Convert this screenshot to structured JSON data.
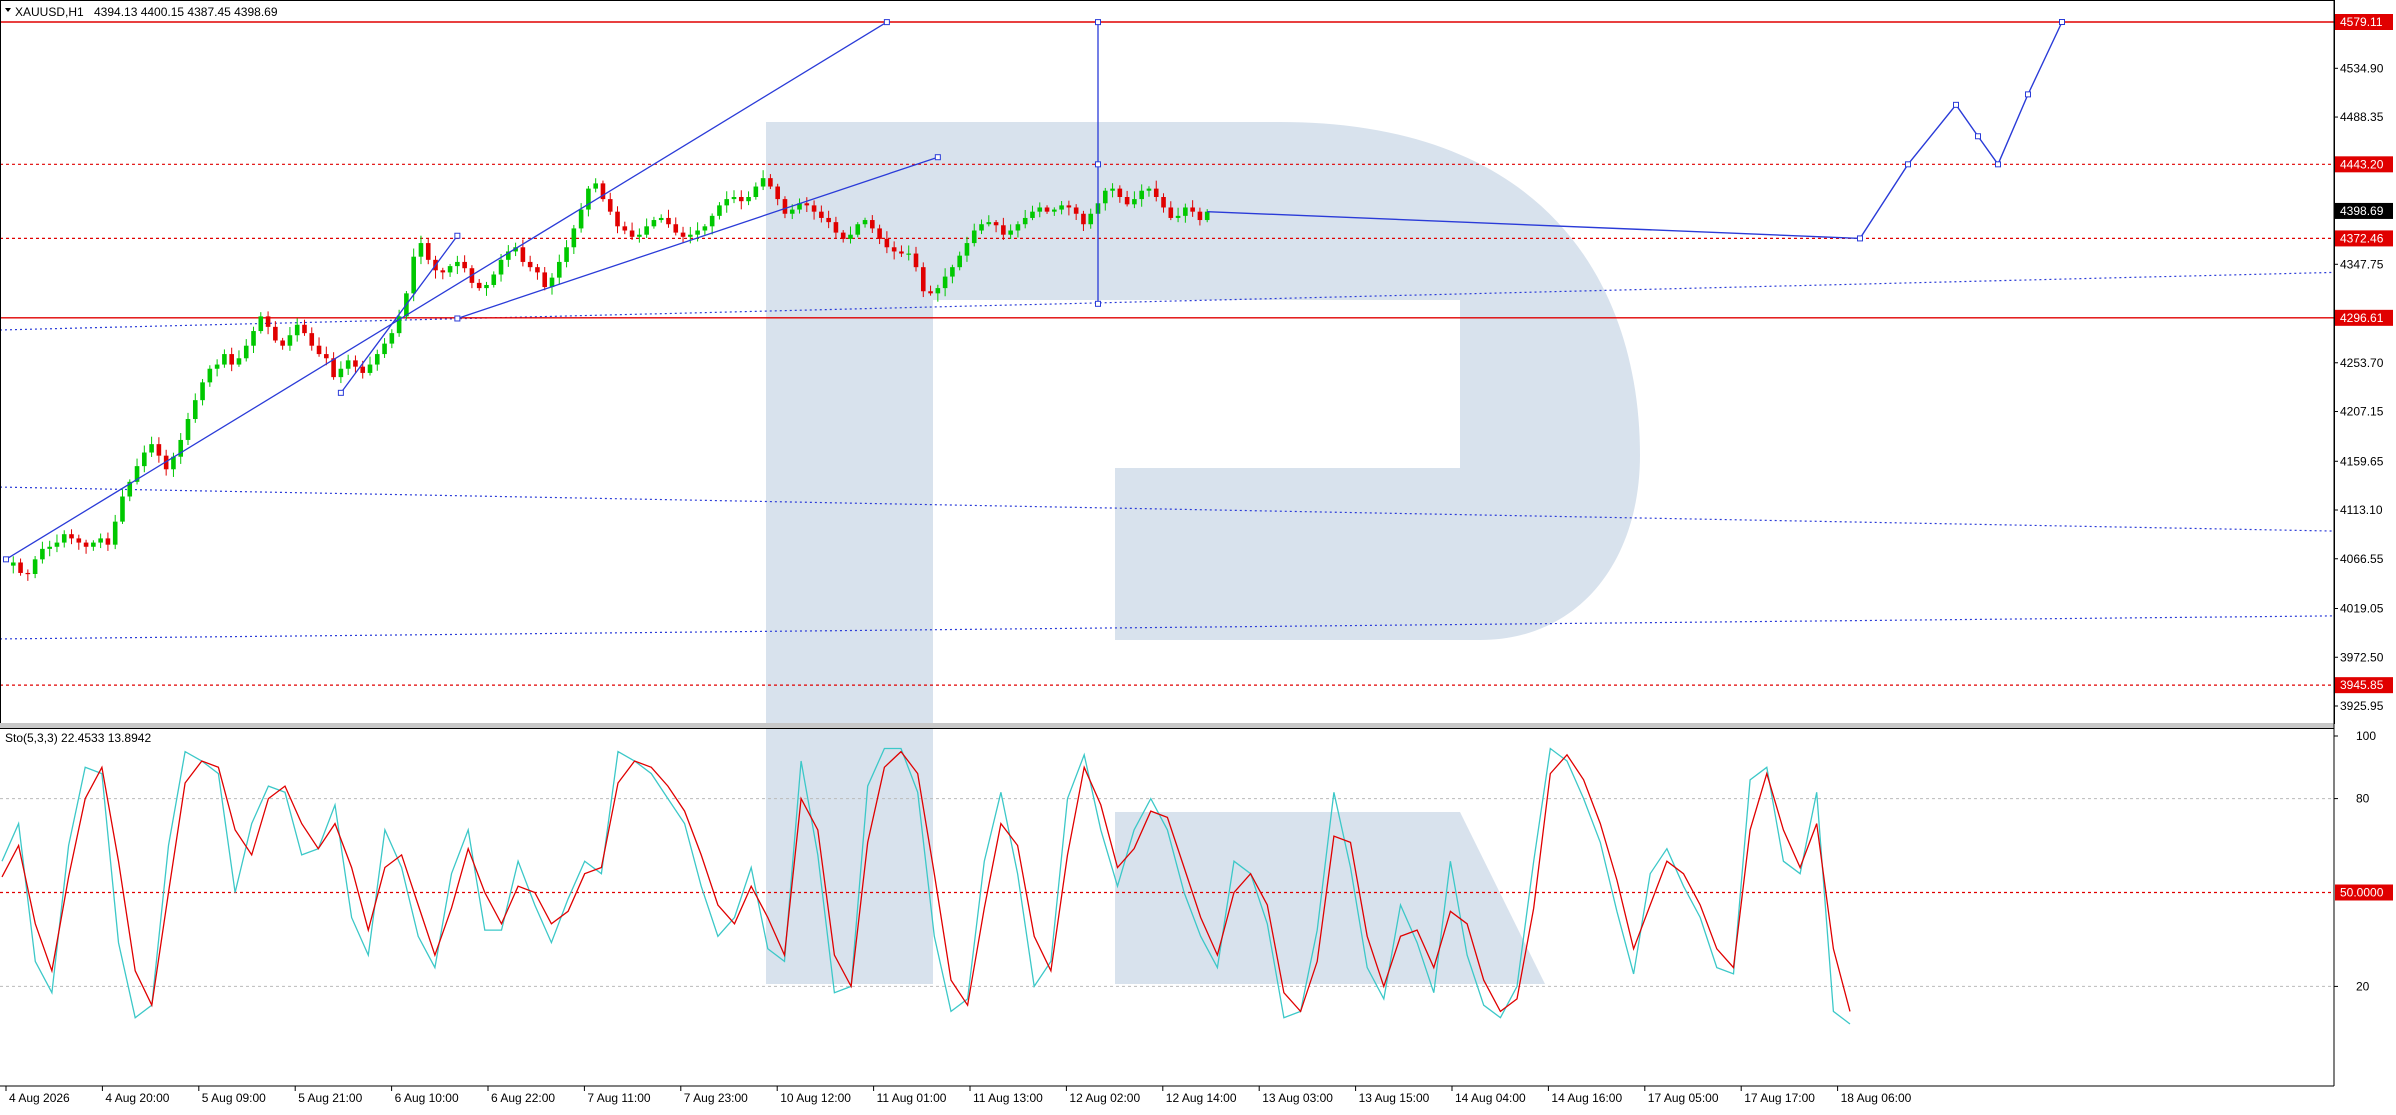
{
  "header": {
    "symbol": "XAUUSD,H1",
    "ohlc": "4394.13 4400.15 4387.45 4398.69"
  },
  "colors": {
    "bull": "#00c800",
    "bear": "#e00000",
    "forecast": "#2a3bd8",
    "level": "#e00000",
    "stoch_k": "#3cc8c8",
    "stoch_d": "#e00000",
    "watermark": "#d6e0ec",
    "price_tag": "#e00000",
    "current_tag": "#000000"
  },
  "chart_data": [
    {
      "type": "candlestick",
      "symbol": "XAUUSD",
      "timeframe": "H1",
      "x_labels": [
        "4 Aug 2026",
        "4 Aug 20:00",
        "5 Aug 09:00",
        "5 Aug 21:00",
        "6 Aug 10:00",
        "6 Aug 22:00",
        "7 Aug 11:00",
        "7 Aug 23:00",
        "10 Aug 12:00",
        "11 Aug 01:00",
        "11 Aug 13:00",
        "12 Aug 02:00",
        "12 Aug 14:00",
        "13 Aug 03:00",
        "13 Aug 15:00",
        "14 Aug 04:00",
        "14 Aug 16:00",
        "17 Aug 05:00",
        "17 Aug 17:00",
        "18 Aug 06:00"
      ],
      "y_ticks": [
        4534.9,
        4488.35,
        4441.8,
        4347.75,
        4253.7,
        4207.15,
        4159.65,
        4113.1,
        4066.55,
        4019.05,
        3972.5,
        3925.95
      ],
      "ylim": [
        3910,
        4590
      ],
      "levels": [
        {
          "label": "4579.11",
          "value": 4579.11,
          "style": "solid"
        },
        {
          "label": "4443.20",
          "value": 4443.2,
          "style": "dotted"
        },
        {
          "label": "4372.46",
          "value": 4372.46,
          "style": "dotted"
        },
        {
          "label": "4296.61",
          "value": 4296.61,
          "style": "solid"
        },
        {
          "label": "3945.85",
          "value": 3945.85,
          "style": "dotted"
        }
      ],
      "current_price": {
        "label": "4398.69",
        "value": 4398.69
      },
      "price_path": [
        4060,
        4063,
        4053,
        4052,
        4066,
        4076,
        4078,
        4082,
        4090,
        4086,
        4082,
        4078,
        4082,
        4086,
        4080,
        4102,
        4126,
        4140,
        4155,
        4168,
        4176,
        4165,
        4152,
        4164,
        4180,
        4200,
        4218,
        4235,
        4248,
        4252,
        4262,
        4252,
        4258,
        4270,
        4284,
        4298,
        4288,
        4275,
        4270,
        4280,
        4290,
        4282,
        4270,
        4262,
        4258,
        4240,
        4248,
        4256,
        4250,
        4244,
        4252,
        4262,
        4272,
        4282,
        4298,
        4320,
        4355,
        4368,
        4352,
        4342,
        4340,
        4346,
        4350,
        4344,
        4330,
        4325,
        4328,
        4338,
        4352,
        4360,
        4364,
        4350,
        4345,
        4340,
        4326,
        4335,
        4350,
        4364,
        4382,
        4400,
        4420,
        4425,
        4410,
        4398,
        4384,
        4380,
        4374,
        4376,
        4384,
        4390,
        4392,
        4386,
        4378,
        4374,
        4376,
        4380,
        4384,
        4394,
        4404,
        4410,
        4412,
        4408,
        4412,
        4422,
        4430,
        4422,
        4410,
        4396,
        4400,
        4406,
        4404,
        4398,
        4392,
        4388,
        4378,
        4372,
        4376,
        4386,
        4390,
        4382,
        4372,
        4364,
        4360,
        4358,
        4358,
        4345,
        4322,
        4320,
        4325,
        4336,
        4345,
        4356,
        4368,
        4380,
        4386,
        4388,
        4385,
        4376,
        4380,
        4386,
        4392,
        4398,
        4402,
        4398,
        4400,
        4404,
        4402,
        4396,
        4386,
        4396,
        4406,
        4418,
        4420,
        4412,
        4405,
        4410,
        4418,
        4420,
        4412,
        4402,
        4392,
        4394,
        4402,
        4398,
        4390,
        4398
      ],
      "forecast_path": [
        4372.46,
        4443.2,
        4500.0,
        4470.0,
        4443.2,
        4510.0,
        4579.11
      ],
      "trendlines": [
        {
          "from": [
            0,
            4066
          ],
          "to": [
            121,
            4579
          ]
        },
        {
          "from": [
            46,
            4225
          ],
          "to": [
            62,
            4375
          ]
        },
        {
          "from": [
            62,
            4296
          ],
          "to": [
            128,
            4450
          ]
        },
        {
          "from": [
            150,
            4579
          ],
          "to": [
            150,
            4310
          ]
        }
      ],
      "moving_averages": [
        {
          "from": 4285,
          "to": 4340
        },
        {
          "from": 4135,
          "to": 4093
        },
        {
          "from": 3990,
          "to": 4012
        }
      ]
    },
    {
      "type": "line",
      "indicator": "Stochastic",
      "label": "Sto(5,3,3) 22.4533 13.8942",
      "y_ticks": [
        100,
        80,
        20
      ],
      "ylim": [
        0,
        100
      ],
      "level_label": "50.0000",
      "level_value": 50,
      "dotted_levels": [
        80,
        20
      ],
      "series": [
        {
          "name": "K",
          "values": [
            60,
            72,
            28,
            18,
            65,
            90,
            88,
            34,
            10,
            14,
            65,
            95,
            92,
            88,
            50,
            72,
            84,
            82,
            62,
            64,
            78,
            42,
            30,
            70,
            58,
            36,
            26,
            56,
            70,
            38,
            38,
            60,
            46,
            34,
            48,
            60,
            56,
            95,
            92,
            88,
            80,
            72,
            52,
            36,
            42,
            58,
            32,
            28,
            92,
            62,
            18,
            20,
            84,
            96,
            96,
            82,
            36,
            12,
            16,
            60,
            82,
            56,
            20,
            28,
            80,
            94,
            70,
            52,
            70,
            80,
            70,
            50,
            36,
            26,
            60,
            56,
            40,
            10,
            12,
            38,
            82,
            58,
            26,
            16,
            46,
            34,
            18,
            60,
            30,
            14,
            10,
            20,
            60,
            96,
            92,
            80,
            66,
            44,
            24,
            56,
            64,
            52,
            42,
            26,
            24,
            86,
            90,
            60,
            56,
            82,
            12,
            8
          ]
        },
        {
          "name": "D",
          "values": [
            55,
            65,
            40,
            25,
            55,
            80,
            90,
            60,
            25,
            14,
            50,
            85,
            92,
            90,
            70,
            62,
            80,
            84,
            72,
            64,
            72,
            58,
            38,
            58,
            62,
            46,
            30,
            45,
            64,
            50,
            40,
            52,
            50,
            40,
            44,
            56,
            58,
            85,
            92,
            90,
            84,
            76,
            62,
            46,
            40,
            52,
            42,
            30,
            80,
            70,
            30,
            20,
            66,
            90,
            95,
            88,
            56,
            22,
            14,
            45,
            72,
            65,
            36,
            25,
            62,
            90,
            78,
            58,
            64,
            76,
            74,
            58,
            42,
            30,
            50,
            56,
            46,
            18,
            12,
            28,
            68,
            66,
            36,
            20,
            36,
            38,
            26,
            44,
            40,
            22,
            12,
            16,
            45,
            88,
            94,
            86,
            72,
            54,
            32,
            46,
            60,
            56,
            46,
            32,
            26,
            70,
            88,
            70,
            58,
            72,
            32,
            12
          ]
        }
      ]
    }
  ]
}
